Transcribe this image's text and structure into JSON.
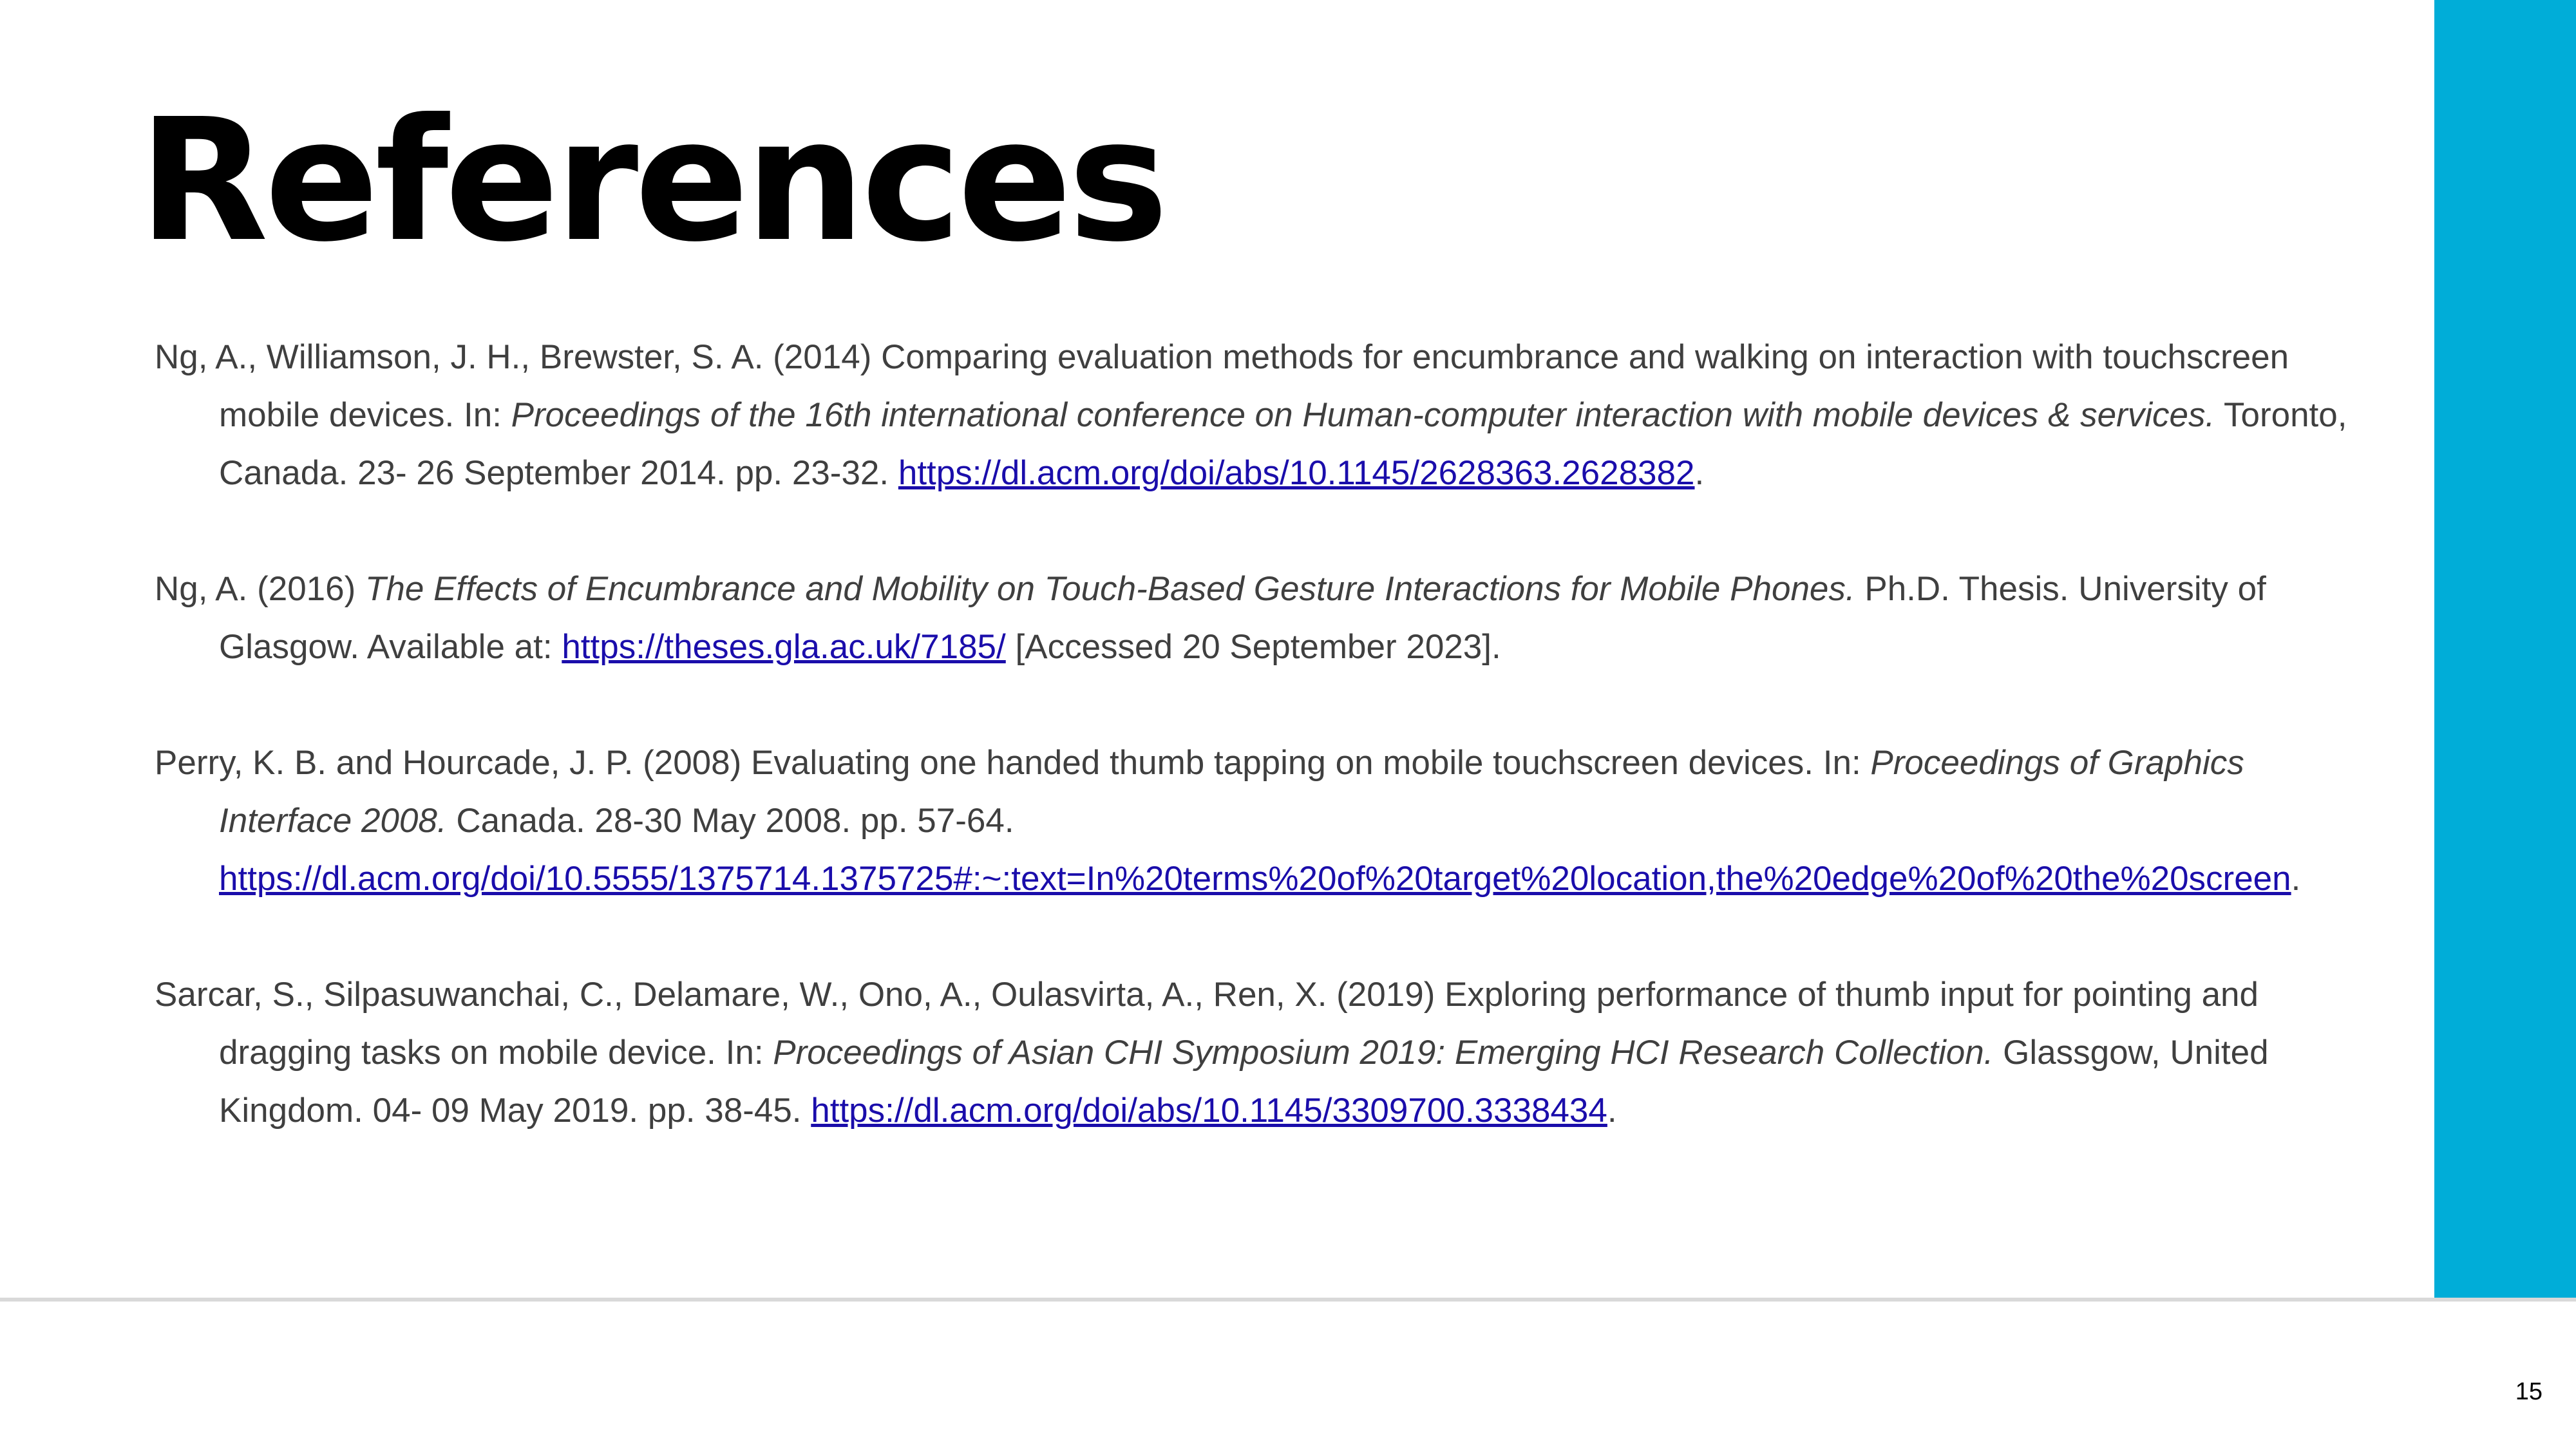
{
  "title": "References",
  "slide_number": "15",
  "colors": {
    "accent": "#00ADD8",
    "link": "#1a0dab",
    "text": "#3f3f3f",
    "divider": "#d9d9d9"
  },
  "references": [
    {
      "lead": "Ng, A., Williamson, J. H., Brewster, S. A. (2014) Comparing evaluation methods for encumbrance and walking on interaction with touchscreen mobile devices. In: ",
      "italic": "Proceedings of the 16th international conference on Human-computer interaction with mobile devices & services.",
      "trail": " Toronto, Canada. 23- 26 September 2014. pp. 23-32. ",
      "link": "https://dl.acm.org/doi/abs/10.1145/2628363.2628382",
      "end": "."
    },
    {
      "lead": "Ng, A. (2016) ",
      "italic": "The Effects of Encumbrance and Mobility on Touch-Based Gesture Interactions for Mobile Phones.",
      "trail": " Ph.D. Thesis. University of Glasgow. Available at: ",
      "link": "https://theses.gla.ac.uk/7185/",
      "end": " [Accessed 20 September 2023]."
    },
    {
      "lead": "Perry, K. B. and Hourcade, J. P. (2008) Evaluating one handed thumb tapping on mobile touchscreen devices. In: ",
      "italic": "Proceedings of Graphics Interface 2008.",
      "trail": " Canada. 28-30 May 2008. pp. 57-64. ",
      "link": "https://dl.acm.org/doi/10.5555/1375714.1375725#:~:text=In%20terms%20of%20target%20location,the%20edge%20of%20the%20screen",
      "end": "."
    },
    {
      "lead": "Sarcar, S., Silpasuwanchai, C., Delamare, W., Ono, A., Oulasvirta, A., Ren, X. (2019) Exploring performance of thumb input for pointing and dragging tasks on mobile device. In: ",
      "italic": "Proceedings of Asian CHI Symposium 2019: Emerging HCI Research Collection.",
      "trail": " Glassgow, United Kingdom. 04- 09 May 2019. pp. 38-45. ",
      "link": "https://dl.acm.org/doi/abs/10.1145/3309700.3338434",
      "end": "."
    }
  ]
}
